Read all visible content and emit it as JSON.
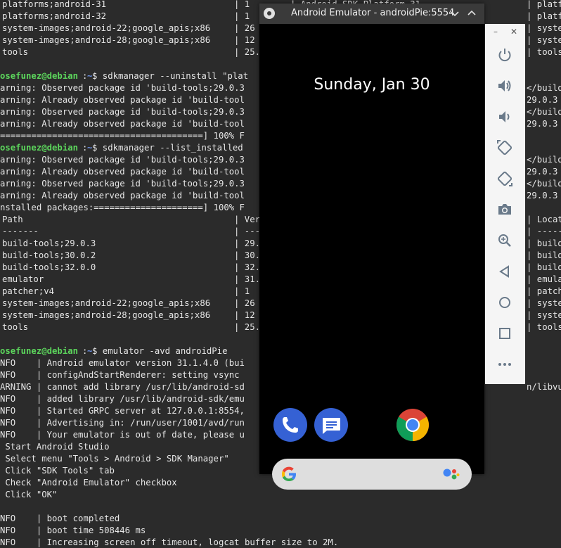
{
  "terminal": {
    "lines": [
      {
        "type": "cols",
        "c1": "platforms;android-31",
        "c2": "| 1",
        "c3": "| Android SDK Platform 31",
        "c4": "| platf"
      },
      {
        "type": "cols",
        "c1": "platforms;android-32",
        "c2": "| 1",
        "c3": "",
        "c4": "| platf"
      },
      {
        "type": "cols",
        "c1": "system-images;android-22;google_apis;x86",
        "c2": "| 26",
        "c3": "",
        "c4": "| syste"
      },
      {
        "type": "cols",
        "c1": "system-images;android-28;google_apis;x86",
        "c2": "| 12",
        "c3": "",
        "c4": "| syste"
      },
      {
        "type": "cols",
        "c1": "tools",
        "c2": "| 25.",
        "c3": "",
        "c4": "| tools"
      },
      {
        "type": "blank"
      },
      {
        "type": "prompt",
        "user": "osefunez@debian",
        "rest": ":",
        "tilde": "~",
        "cmd": "$ sdkmanager --uninstall \"plat",
        "right": ""
      },
      {
        "type": "text",
        "text": "arning: Observed package id 'build-tools;29.0.3",
        "right": "</build-"
      },
      {
        "type": "text",
        "text": "arning: Already observed package id 'build-tool",
        "right": "29.0.3"
      },
      {
        "type": "text",
        "text": "arning: Observed package id 'build-tools;29.0.3",
        "right": "</build-"
      },
      {
        "type": "text",
        "text": "arning: Already observed package id 'build-tool",
        "right": "29.0.3"
      },
      {
        "type": "text",
        "text": "=======================================] 100% F",
        "right": ""
      },
      {
        "type": "prompt",
        "user": "osefunez@debian",
        "rest": ":",
        "tilde": "~",
        "cmd": "$ sdkmanager --list_installed",
        "right": ""
      },
      {
        "type": "text",
        "text": "arning: Observed package id 'build-tools;29.0.3",
        "right": "</build-"
      },
      {
        "type": "text",
        "text": "arning: Already observed package id 'build-tool",
        "right": "29.0.3"
      },
      {
        "type": "text",
        "text": "arning: Observed package id 'build-tools;29.0.3",
        "right": "</build-"
      },
      {
        "type": "text",
        "text": "arning: Already observed package id 'build-tool",
        "right": "29.0.3"
      },
      {
        "type": "text",
        "text": "nstalled packages:=====================] 100% F",
        "right": ""
      },
      {
        "type": "cols",
        "c1": "Path",
        "c2": "| Ver",
        "c3": "",
        "c4": "| Locat"
      },
      {
        "type": "cols",
        "c1": "-------",
        "c2": "| ---",
        "c3": "",
        "c4": "| -----"
      },
      {
        "type": "cols",
        "c1": "build-tools;29.0.3",
        "c2": "| 29.",
        "c3": "",
        "c4": "| build"
      },
      {
        "type": "cols",
        "c1": "build-tools;30.0.2",
        "c2": "| 30.",
        "c3": "",
        "c4": "| build"
      },
      {
        "type": "cols",
        "c1": "build-tools;32.0.0",
        "c2": "| 32.",
        "c3": "",
        "c4": "| build"
      },
      {
        "type": "cols",
        "c1": "emulator",
        "c2": "| 31.",
        "c3": "",
        "c4": "| emula"
      },
      {
        "type": "cols",
        "c1": "patcher;v4",
        "c2": "| 1",
        "c3": "",
        "c4": "| patch"
      },
      {
        "type": "cols",
        "c1": "system-images;android-22;google_apis;x86",
        "c2": "| 26",
        "c3": "",
        "c4": "| syste"
      },
      {
        "type": "cols",
        "c1": "system-images;android-28;google_apis;x86",
        "c2": "| 12",
        "c3": "",
        "c4": "| syste"
      },
      {
        "type": "cols",
        "c1": "tools",
        "c2": "| 25.",
        "c3": "",
        "c4": "| tools"
      },
      {
        "type": "blank"
      },
      {
        "type": "prompt",
        "user": "osefunez@debian",
        "rest": ":",
        "tilde": "~",
        "cmd": "$ emulator -avd androidPie",
        "right": ""
      },
      {
        "type": "text",
        "text": "NFO    | Android emulator version 31.1.4.0 (bui",
        "right": ""
      },
      {
        "type": "text",
        "text": "NFO    | configAndStartRenderer: setting vsync ",
        "right": ""
      },
      {
        "type": "text",
        "text": "ARNING | cannot add library /usr/lib/android-sd",
        "right": "n/libvulkan.so"
      },
      {
        "type": "text",
        "text": "NFO    | added library /usr/lib/android-sdk/emu",
        "right": ""
      },
      {
        "type": "text",
        "text": "NFO    | Started GRPC server at 127.0.0.1:8554,",
        "right": ""
      },
      {
        "type": "text",
        "text": "NFO    | Advertising in: /run/user/1001/avd/run",
        "right": ""
      },
      {
        "type": "text",
        "text": "NFO    | Your emulator is out of date, please u",
        "right": ""
      },
      {
        "type": "text",
        "text": " Start Android Studio",
        "right": ""
      },
      {
        "type": "text",
        "text": " Select menu \"Tools > Android > SDK Manager\"",
        "right": ""
      },
      {
        "type": "text",
        "text": " Click \"SDK Tools\" tab",
        "right": ""
      },
      {
        "type": "text",
        "text": " Check \"Android Emulator\" checkbox",
        "right": ""
      },
      {
        "type": "text",
        "text": " Click \"OK\"",
        "right": ""
      },
      {
        "type": "blank"
      },
      {
        "type": "text",
        "text": "NFO    | boot completed",
        "right": ""
      },
      {
        "type": "text",
        "text": "NFO    | boot time 508446 ms",
        "right": ""
      },
      {
        "type": "text",
        "text": "NFO    | Increasing screen off timeout, logcat buffer size to 2M.",
        "right": ""
      }
    ]
  },
  "emulator": {
    "title": "Android Emulator - androidPie:5554",
    "date": "Sunday, Jan 30",
    "minimize": "–",
    "close": "✕"
  },
  "colors": {
    "terminal_bg": "#2b2b2b",
    "user_green": "#5cd65c",
    "phone_blue": "#3561d4",
    "messages_blue": "#3561d4"
  }
}
